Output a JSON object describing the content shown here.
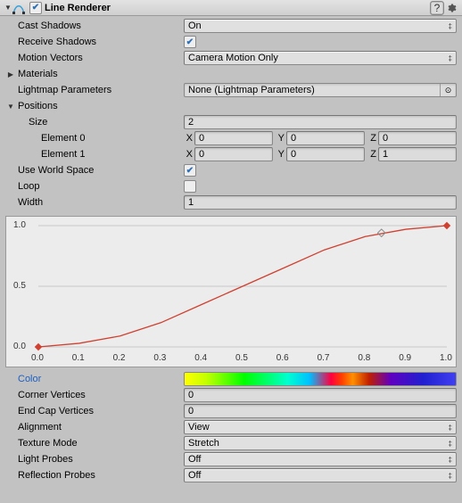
{
  "header": {
    "title": "Line Renderer",
    "enabled": true
  },
  "props": {
    "castShadows": {
      "label": "Cast Shadows",
      "value": "On"
    },
    "receiveShadows": {
      "label": "Receive Shadows",
      "checked": true
    },
    "motionVectors": {
      "label": "Motion Vectors",
      "value": "Camera Motion Only"
    },
    "materials": {
      "label": "Materials"
    },
    "lightmap": {
      "label": "Lightmap Parameters",
      "value": "None (Lightmap Parameters)"
    },
    "positions": {
      "label": "Positions"
    },
    "size": {
      "label": "Size",
      "value": "2"
    },
    "el0": {
      "label": "Element 0",
      "x": "0",
      "y": "0",
      "z": "0"
    },
    "el1": {
      "label": "Element 1",
      "x": "0",
      "y": "0",
      "z": "1"
    },
    "useWorld": {
      "label": "Use World Space",
      "checked": true
    },
    "loop": {
      "label": "Loop",
      "checked": false
    },
    "width": {
      "label": "Width",
      "value": "1"
    },
    "colorLabel": "Color",
    "cornerVerts": {
      "label": "Corner Vertices",
      "value": "0"
    },
    "endCapVerts": {
      "label": "End Cap Vertices",
      "value": "0"
    },
    "alignment": {
      "label": "Alignment",
      "value": "View"
    },
    "textureMode": {
      "label": "Texture Mode",
      "value": "Stretch"
    },
    "lightProbes": {
      "label": "Light Probes",
      "value": "Off"
    },
    "reflectionProbes": {
      "label": "Reflection Probes",
      "value": "Off"
    }
  },
  "axis": {
    "xlabels": [
      "0.0",
      "0.1",
      "0.2",
      "0.3",
      "0.4",
      "0.5",
      "0.6",
      "0.7",
      "0.8",
      "0.9",
      "1.0"
    ],
    "ylabels": [
      "0.0",
      "0.5",
      "1.0"
    ]
  },
  "chart_data": {
    "type": "line",
    "title": "",
    "xlabel": "",
    "ylabel": "",
    "xlim": [
      0.0,
      1.0
    ],
    "ylim": [
      0.0,
      1.0
    ],
    "x": [
      0.0,
      0.1,
      0.2,
      0.3,
      0.4,
      0.5,
      0.6,
      0.7,
      0.8,
      0.9,
      1.0
    ],
    "values": [
      0.0,
      0.03,
      0.09,
      0.2,
      0.35,
      0.5,
      0.65,
      0.8,
      0.91,
      0.97,
      1.0
    ],
    "keys": [
      {
        "x": 0.0,
        "y": 0.0
      },
      {
        "x": 1.0,
        "y": 1.0
      }
    ],
    "tangent_handles": [
      {
        "x": 0.84,
        "y": 0.94
      }
    ],
    "color": "#d04030"
  }
}
